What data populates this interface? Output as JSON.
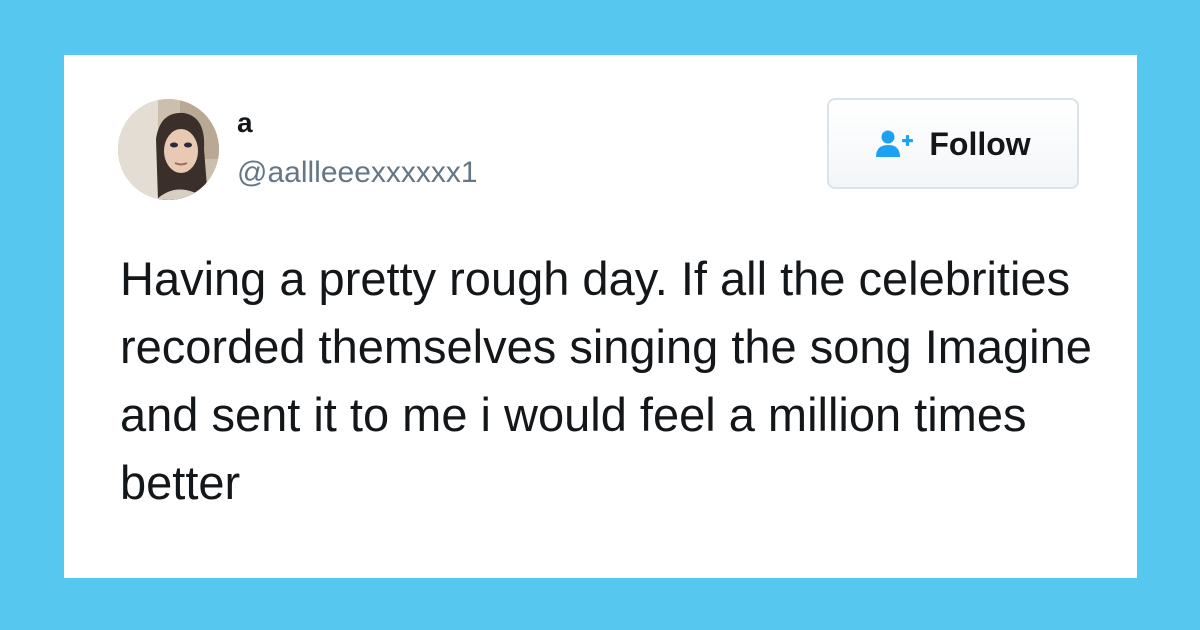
{
  "colors": {
    "background": "#56c7ee",
    "card": "#ffffff",
    "text": "#14171a",
    "handle": "#657786",
    "follow_icon": "#1da1f2"
  },
  "user": {
    "display_name": "a",
    "handle": "@aallleeexxxxxx1"
  },
  "follow_button": {
    "label": "Follow",
    "icon": "add-user-icon"
  },
  "tweet": {
    "text": "Having a pretty rough day. If all the celebrities recorded themselves singing the song Imagine and sent it to me i would feel a million times better"
  }
}
